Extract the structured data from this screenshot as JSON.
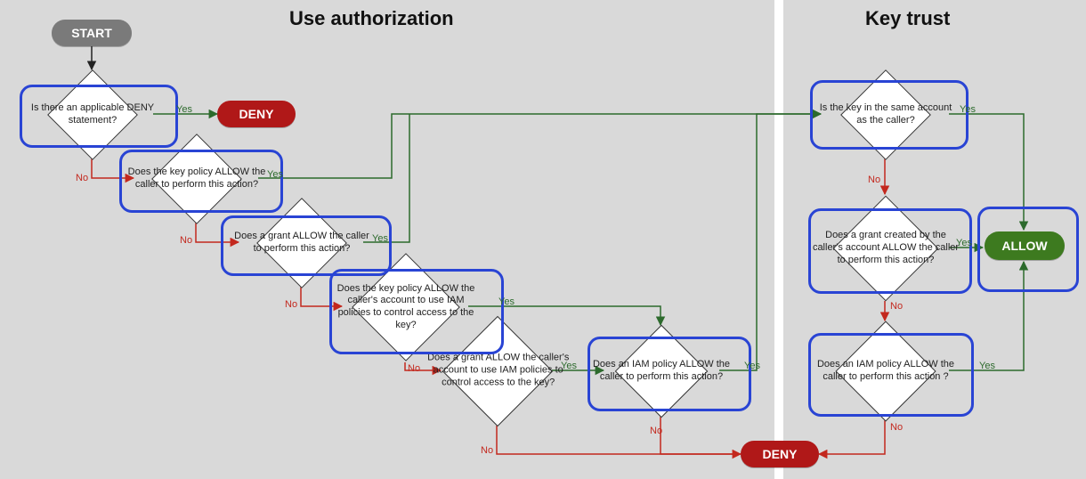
{
  "sections": {
    "left_title": "Use authorization",
    "right_title": "Key trust"
  },
  "start": "START",
  "deny": "DENY",
  "allow": "ALLOW",
  "labels": {
    "yes": "Yes",
    "no": "No"
  },
  "decisions": {
    "d1": "Is there an applicable DENY statement?",
    "d2": "Does the key policy ALLOW the caller to perform this action?",
    "d3": "Does a grant ALLOW the caller to perform this action?",
    "d4": "Does the key policy ALLOW the caller's account to use IAM policies to control access to the key?",
    "d5": "Does a grant ALLOW the caller's account to use IAM policies to control access to the key?",
    "d6": "Does an IAM policy ALLOW the caller to perform this action?",
    "k1": "Is the key in the same account as the caller?",
    "k2": "Does a grant created by the caller's account ALLOW the caller to perform this action?",
    "k3": "Does an IAM policy ALLOW the caller to perform this action ?"
  },
  "chart_data": {
    "type": "flowchart",
    "sections": [
      {
        "id": "use_auth",
        "title": "Use authorization"
      },
      {
        "id": "key_trust",
        "title": "Key trust"
      }
    ],
    "nodes": [
      {
        "id": "start",
        "type": "terminator",
        "label": "START",
        "section": "use_auth"
      },
      {
        "id": "d1",
        "type": "decision",
        "label": "Is there an applicable DENY statement?",
        "section": "use_auth",
        "highlighted": true
      },
      {
        "id": "deny1",
        "type": "terminator",
        "label": "DENY",
        "color": "red",
        "section": "use_auth"
      },
      {
        "id": "d2",
        "type": "decision",
        "label": "Does the key policy ALLOW the caller to perform this action?",
        "section": "use_auth",
        "highlighted": true
      },
      {
        "id": "d3",
        "type": "decision",
        "label": "Does a grant ALLOW the caller to perform this action?",
        "section": "use_auth",
        "highlighted": true
      },
      {
        "id": "d4",
        "type": "decision",
        "label": "Does the key policy ALLOW the caller's account to use IAM policies to control access to the key?",
        "section": "use_auth",
        "highlighted": true
      },
      {
        "id": "d5",
        "type": "decision",
        "label": "Does a grant ALLOW the caller's account to use IAM policies to control access to the key?",
        "section": "use_auth"
      },
      {
        "id": "d6",
        "type": "decision",
        "label": "Does an IAM policy ALLOW the caller to perform this action?",
        "section": "use_auth",
        "highlighted": true
      },
      {
        "id": "deny2",
        "type": "terminator",
        "label": "DENY",
        "color": "red",
        "section": "use_auth"
      },
      {
        "id": "k1",
        "type": "decision",
        "label": "Is the key in the same account as the caller?",
        "section": "key_trust",
        "highlighted": true
      },
      {
        "id": "k2",
        "type": "decision",
        "label": "Does a grant created by the caller's account ALLOW the caller to perform this action?",
        "section": "key_trust",
        "highlighted": true
      },
      {
        "id": "k3",
        "type": "decision",
        "label": "Does an IAM policy ALLOW the caller to perform this action ?",
        "section": "key_trust",
        "highlighted": true
      },
      {
        "id": "allow",
        "type": "terminator",
        "label": "ALLOW",
        "color": "green",
        "section": "key_trust",
        "highlighted": true
      }
    ],
    "edges": [
      {
        "from": "start",
        "to": "d1",
        "label": null
      },
      {
        "from": "d1",
        "to": "deny1",
        "label": "Yes"
      },
      {
        "from": "d1",
        "to": "d2",
        "label": "No"
      },
      {
        "from": "d2",
        "to": "k1",
        "label": "Yes"
      },
      {
        "from": "d2",
        "to": "d3",
        "label": "No"
      },
      {
        "from": "d3",
        "to": "k1",
        "label": "Yes"
      },
      {
        "from": "d3",
        "to": "d4",
        "label": "No"
      },
      {
        "from": "d4",
        "to": "d6",
        "label": "Yes"
      },
      {
        "from": "d4",
        "to": "d5",
        "label": "No"
      },
      {
        "from": "d5",
        "to": "d6",
        "label": "Yes"
      },
      {
        "from": "d5",
        "to": "deny2",
        "label": "No"
      },
      {
        "from": "d6",
        "to": "k1",
        "label": "Yes"
      },
      {
        "from": "d6",
        "to": "deny2",
        "label": "No"
      },
      {
        "from": "k1",
        "to": "allow",
        "label": "Yes"
      },
      {
        "from": "k1",
        "to": "k2",
        "label": "No"
      },
      {
        "from": "k2",
        "to": "allow",
        "label": "Yes"
      },
      {
        "from": "k2",
        "to": "k3",
        "label": "No"
      },
      {
        "from": "k3",
        "to": "allow",
        "label": "Yes"
      },
      {
        "from": "k3",
        "to": "deny2",
        "label": "No"
      }
    ]
  }
}
